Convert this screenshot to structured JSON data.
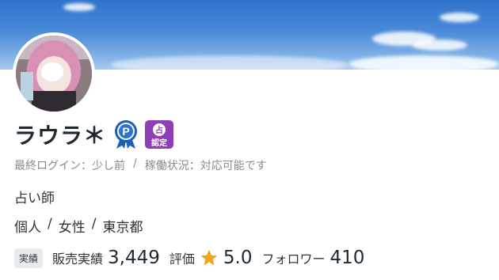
{
  "profile": {
    "name": "ラウラ",
    "name_mark": "＊",
    "badges": {
      "p": "P",
      "cert_top": "占",
      "cert_bottom": "認定"
    },
    "status": {
      "last_login_label": "最終ログイン",
      "last_login_value": "少し前",
      "separator": "/",
      "work_status_label": "稼働状況",
      "work_status_value": "対応可能です",
      "colon": "："
    },
    "role": "占い師",
    "meta": [
      "個人",
      "女性",
      "東京都"
    ],
    "meta_separator": "/",
    "stats": {
      "tag": "実績",
      "sales_label": "販売実績",
      "sales_value": "3,449",
      "rating_label": "評価",
      "rating_value": "5.0",
      "followers_label": "フォロワー",
      "followers_value": "410"
    }
  },
  "colors": {
    "name": "#1e2a30",
    "badge_blue": "#1f5fb8",
    "badge_purple": "#8e3fb4",
    "star": "#f3a21b"
  }
}
